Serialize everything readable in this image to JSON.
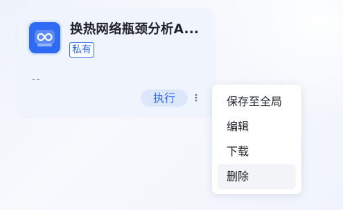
{
  "card": {
    "title": "换热网络瓶颈分析A...",
    "tag": "私有",
    "description": "--",
    "run_label": "执行",
    "icon": "app-loop-icon",
    "more_icon": "more-vertical-icon"
  },
  "menu": {
    "items": [
      {
        "label": "保存至全局"
      },
      {
        "label": "编辑"
      },
      {
        "label": "下载"
      },
      {
        "label": "删除"
      }
    ]
  },
  "colors": {
    "accent": "#2f6bf2",
    "card_bg": "#f0f4fd",
    "run_bg": "#dde7fc",
    "hover_bg": "#f2f4f7"
  }
}
